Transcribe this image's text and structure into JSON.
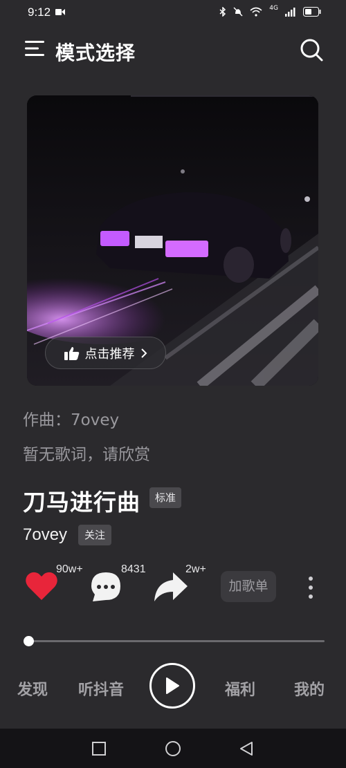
{
  "status_bar": {
    "time": "9:12",
    "network": "4G"
  },
  "header": {
    "title": "模式选择"
  },
  "cover": {
    "recommend_label": "点击推荐"
  },
  "info": {
    "composer": "作曲：7ovey",
    "lyrics_note": "暂无歌词，请欣赏"
  },
  "song": {
    "title": "刀马进行曲",
    "quality_tag": "标准",
    "artist": "7ovey",
    "follow_label": "关注"
  },
  "actions": {
    "likes": "90w+",
    "comments": "8431",
    "shares": "2w+",
    "add_playlist_label": "加歌单"
  },
  "progress": {
    "fraction": 0.0
  },
  "tabs": [
    "发现",
    "听抖音",
    "福利",
    "我的"
  ],
  "colors": {
    "like": "#e8253a",
    "background": "#2b2a2d"
  }
}
